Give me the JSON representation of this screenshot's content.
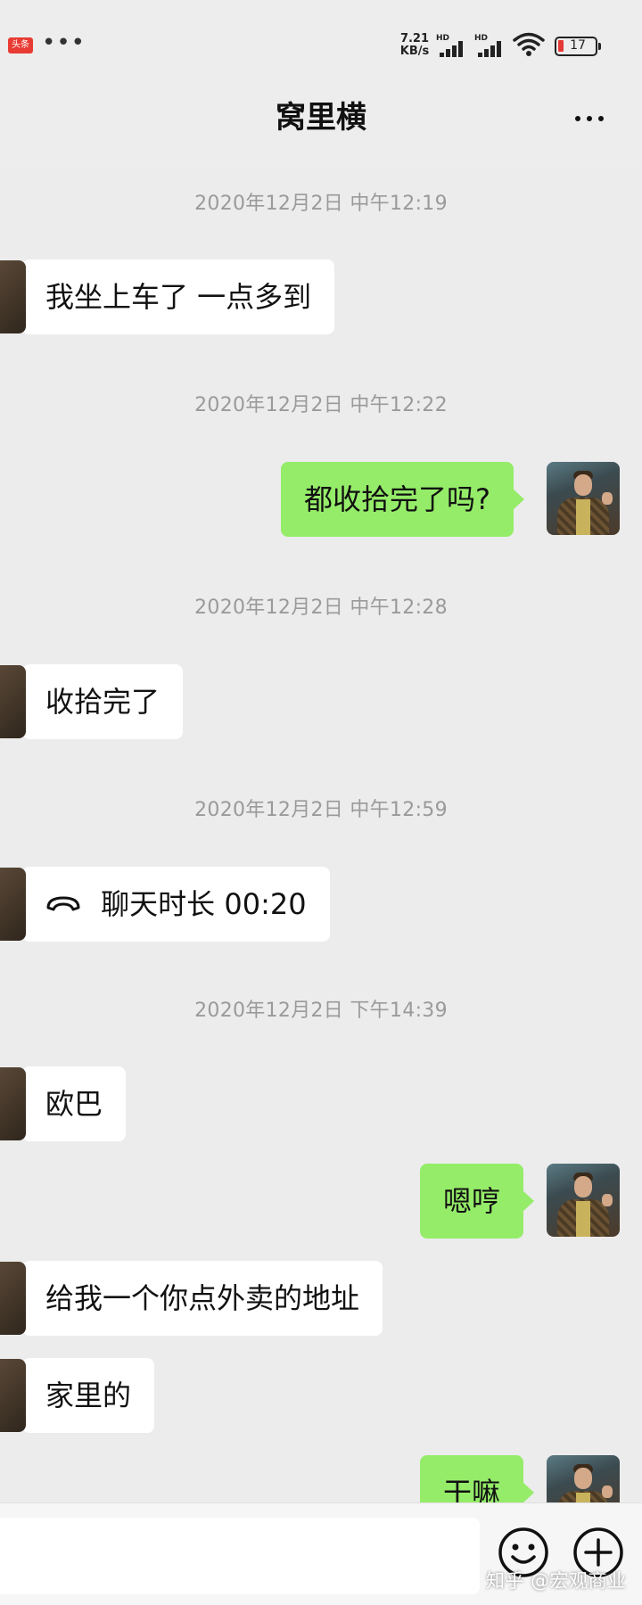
{
  "status_bar": {
    "app_badge": "头条",
    "overflow": "•••",
    "net_speed_value": "7.21",
    "net_speed_unit": "KB/s",
    "signal_1_label": "HD",
    "signal_2_label": "HD",
    "battery_level": "17"
  },
  "header": {
    "title": "窝里横",
    "more_icon": "more-dots-icon"
  },
  "messages": [
    {
      "type": "time",
      "text": "2020年12月2日 中午12:19"
    },
    {
      "type": "text",
      "side": "in",
      "text": "我坐上车了 一点多到"
    },
    {
      "type": "time",
      "text": "2020年12月2日 中午12:22"
    },
    {
      "type": "text",
      "side": "out",
      "text": "都收拾完了吗?"
    },
    {
      "type": "time",
      "text": "2020年12月2日 中午12:28"
    },
    {
      "type": "text",
      "side": "in",
      "text": "收拾完了"
    },
    {
      "type": "time",
      "text": "2020年12月2日 中午12:59"
    },
    {
      "type": "call",
      "side": "in",
      "text": "聊天时长 00:20",
      "icon": "phone-hangup-icon"
    },
    {
      "type": "time",
      "text": "2020年12月2日 下午14:39"
    },
    {
      "type": "text",
      "side": "in",
      "text": "欧巴"
    },
    {
      "type": "text",
      "side": "out",
      "text": "嗯哼"
    },
    {
      "type": "text",
      "side": "in",
      "text": "给我一个你点外卖的地址"
    },
    {
      "type": "text",
      "side": "in",
      "text": "家里的"
    },
    {
      "type": "text",
      "side": "out",
      "text": "干嘛"
    }
  ],
  "input_bar": {
    "placeholder": "",
    "emoji_icon": "emoji-smile-icon",
    "plus_icon": "plus-circle-icon"
  },
  "watermark": "知乎 @宏观商业",
  "colors": {
    "outgoing_bubble": "#95ec69",
    "incoming_bubble": "#ffffff",
    "background": "#ececec",
    "timestamp": "#9a9a9a"
  }
}
